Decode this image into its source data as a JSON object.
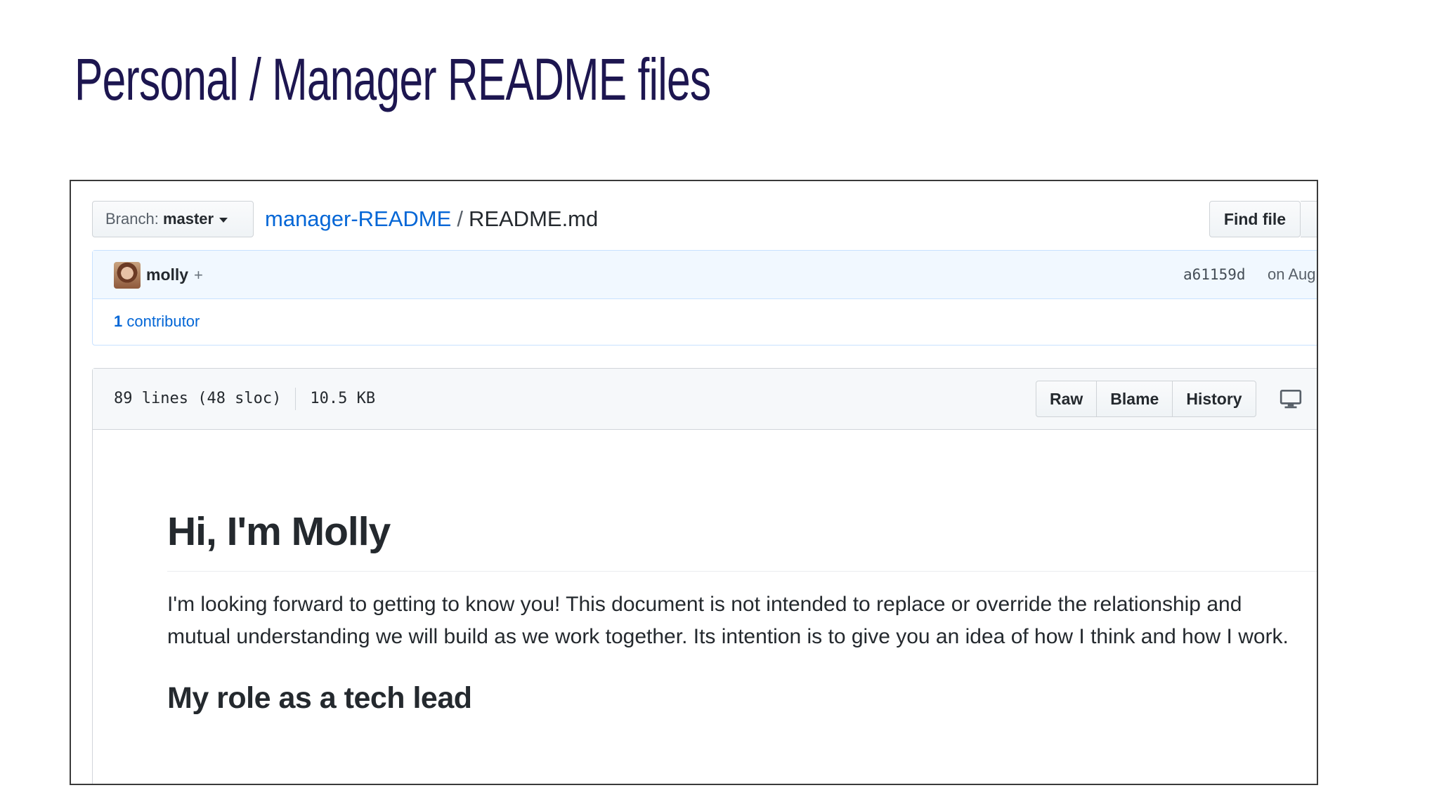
{
  "slide": {
    "title": "Personal / Manager README files"
  },
  "github": {
    "branch": {
      "prefix": "Branch:",
      "name": "master"
    },
    "breadcrumb": {
      "repo": "manager-README",
      "separator": "/",
      "file": "README.md"
    },
    "find_file_label": "Find file",
    "commit": {
      "author": "molly",
      "coauthor_plus": "+",
      "sha": "a61159d",
      "date": "on Aug"
    },
    "contributors": {
      "count": "1",
      "label": "contributor"
    },
    "file_info": {
      "lines": "89 lines (48 sloc)",
      "size": "10.5 KB"
    },
    "buttons": {
      "raw": "Raw",
      "blame": "Blame",
      "history": "History"
    },
    "icons": {
      "desktop": "desktop-icon",
      "caret": "caret-down-icon"
    },
    "readme": {
      "heading": "Hi, I'm Molly",
      "paragraph": "I'm looking forward to getting to know you! This document is not intended to replace or override the relationship and mutual understanding we will build as we work together. Its intention is to give you an idea of how I think and how I work.",
      "subheading": "My role as a tech lead"
    },
    "colors": {
      "title": "#1d1650",
      "link": "#0366d6",
      "commit_bg": "#f1f8ff"
    }
  }
}
